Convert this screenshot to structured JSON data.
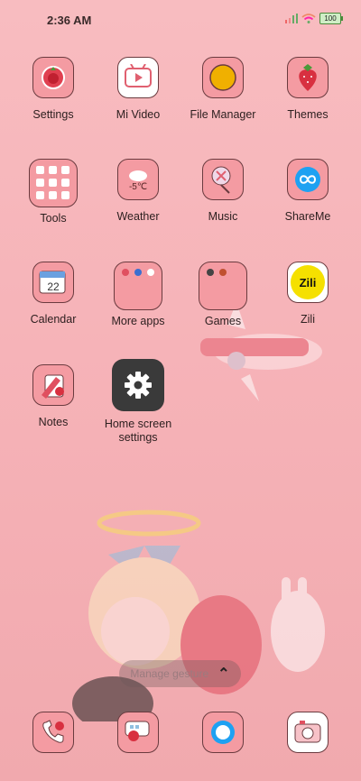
{
  "status_bar": {
    "time": "2:36 AM",
    "battery": "100"
  },
  "apps": [
    {
      "label": "Settings"
    },
    {
      "label": "Mi Video"
    },
    {
      "label": "File Manager"
    },
    {
      "label": "Themes"
    },
    {
      "label": "Tools"
    },
    {
      "label": "Weather",
      "weather_temp": "-5℃"
    },
    {
      "label": "Music"
    },
    {
      "label": "ShareMe"
    },
    {
      "label": "Calendar",
      "calendar_day": "22"
    },
    {
      "label": "More apps"
    },
    {
      "label": "Games"
    },
    {
      "label": "Zili",
      "zili_text": "Zili"
    },
    {
      "label": "Notes"
    },
    {
      "label": "Home screen settings"
    }
  ],
  "dock": {
    "items": [
      "phone",
      "messages",
      "browser",
      "camera"
    ]
  },
  "gesture_pill": {
    "text": "Manage gesture"
  },
  "colors": {
    "icon_bg": "#f49ba2",
    "icon_border": "#6a3b3f",
    "background": "#f6b3b8",
    "file_manager": "#f0b000",
    "shareme": "#1ea1f2"
  }
}
